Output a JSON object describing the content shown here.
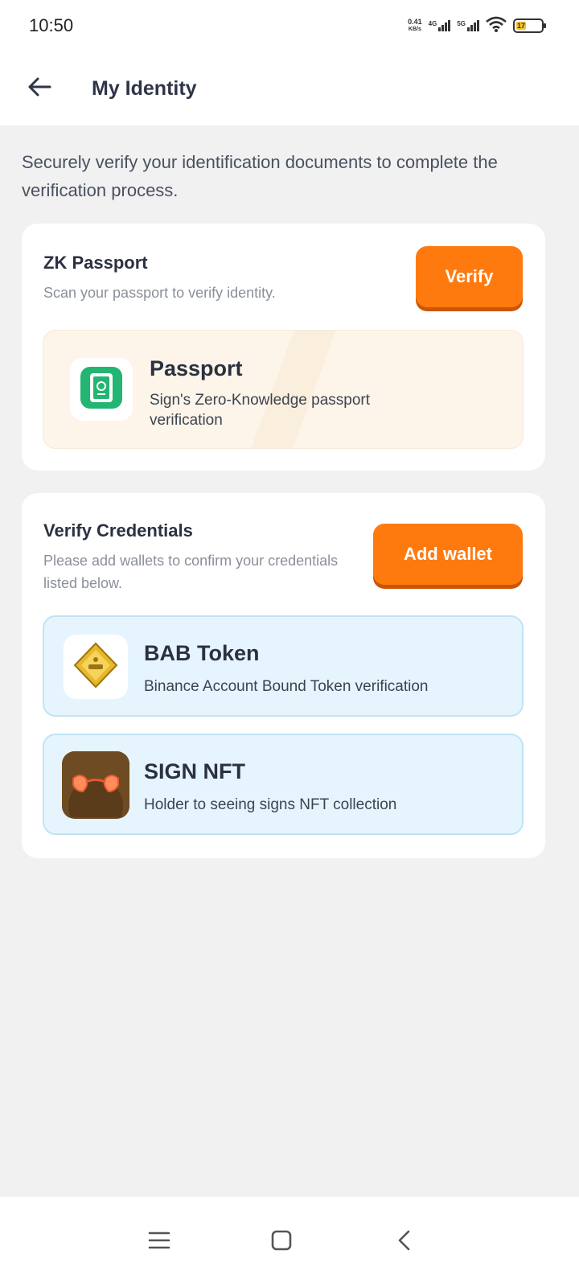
{
  "status_bar": {
    "time": "10:50",
    "net_speed_value": "0.41",
    "net_speed_unit": "KB/s",
    "signal_1_label": "4G",
    "signal_2_label": "5G",
    "battery_level": "17",
    "icons": [
      "signal-icon",
      "signal-icon",
      "wifi-icon",
      "battery-icon"
    ]
  },
  "app_bar": {
    "title": "My Identity",
    "back_icon": "arrow-left-icon"
  },
  "intro_text": "Securely verify your identification documents to complete the verification process.",
  "zk_passport": {
    "title": "ZK Passport",
    "subtitle": "Scan your passport to verify identity.",
    "button_label": "Verify",
    "item": {
      "title": "Passport",
      "description": "Sign's Zero-Knowledge passport verification",
      "icon": "passport-icon"
    }
  },
  "verify_credentials": {
    "title": "Verify Credentials",
    "subtitle": "Please add wallets to confirm your credentials listed below.",
    "button_label": "Add wallet",
    "items": [
      {
        "title": "BAB Token",
        "description": "Binance Account Bound Token verification",
        "icon": "bab-token-icon"
      },
      {
        "title": "SIGN NFT",
        "description": "Holder to seeing signs NFT collection",
        "icon": "sign-nft-icon"
      }
    ]
  },
  "nav_bar": {
    "icons": [
      "menu-icon",
      "home-icon",
      "back-icon"
    ]
  },
  "colors": {
    "accent": "#ff7a0e",
    "background": "#f1f1f1",
    "credential_card": "#e6f5fd",
    "passport_card": "#fdf5e9"
  }
}
